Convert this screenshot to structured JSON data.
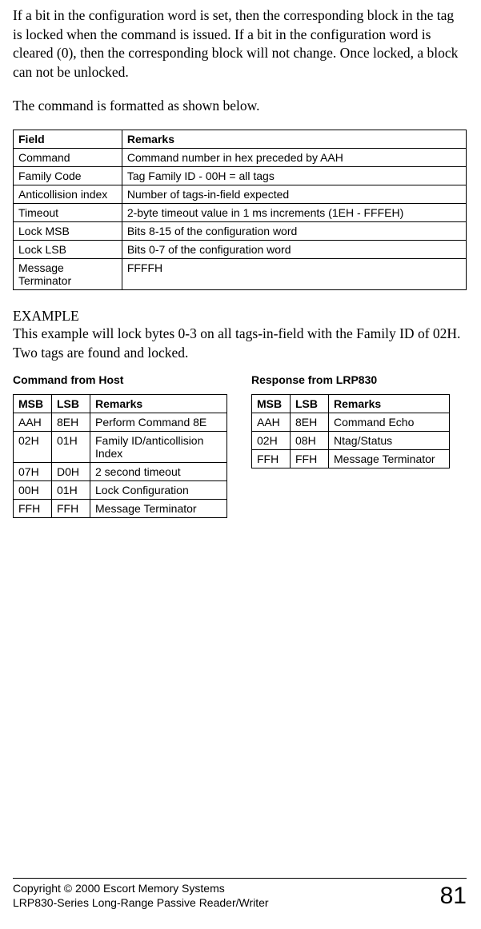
{
  "para1": "If a bit in the configuration word is set, then the corresponding block in the tag is locked when the command is issued. If a bit in the configuration word is cleared (0), then the corresponding block will not change. Once locked, a block can not be unlocked.",
  "para2": "The command is formatted as shown below.",
  "main_table": {
    "headers": {
      "field": "Field",
      "remarks": "Remarks"
    },
    "rows": [
      {
        "field": "Command",
        "remarks": "Command number in hex preceded by AAH"
      },
      {
        "field": "Family Code",
        "remarks": "Tag Family ID - 00H = all tags"
      },
      {
        "field": "Anticollision index",
        "remarks": "Number of tags-in-field expected"
      },
      {
        "field": "Timeout",
        "remarks": "2-byte timeout value in 1 ms increments (1EH - FFFEH)"
      },
      {
        "field": "Lock MSB",
        "remarks": "Bits 8-15 of the configuration word"
      },
      {
        "field": "Lock LSB",
        "remarks": "Bits 0-7 of the configuration word"
      },
      {
        "field": "Message Terminator",
        "remarks": "FFFFH"
      }
    ]
  },
  "example": {
    "heading": "EXAMPLE",
    "body": "This example will lock bytes 0-3 on all tags-in-field with the Family ID of 02H. Two tags are found and locked."
  },
  "host": {
    "title": "Command from Host",
    "headers": {
      "msb": "MSB",
      "lsb": "LSB",
      "remarks": "Remarks"
    },
    "rows": [
      {
        "msb": "AAH",
        "lsb": "8EH",
        "remarks": "Perform Command 8E"
      },
      {
        "msb": "02H",
        "lsb": "01H",
        "remarks": "Family ID/anticollision Index"
      },
      {
        "msb": "07H",
        "lsb": "D0H",
        "remarks": "2 second timeout"
      },
      {
        "msb": "00H",
        "lsb": "01H",
        "remarks": "Lock Configuration"
      },
      {
        "msb": "FFH",
        "lsb": "FFH",
        "remarks": "Message Terminator"
      }
    ]
  },
  "resp": {
    "title": "Response from LRP830",
    "headers": {
      "msb": "MSB",
      "lsb": "LSB",
      "remarks": "Remarks"
    },
    "rows": [
      {
        "msb": "AAH",
        "lsb": "8EH",
        "remarks": "Command Echo"
      },
      {
        "msb": "02H",
        "lsb": "08H",
        "remarks": "Ntag/Status"
      },
      {
        "msb": "FFH",
        "lsb": "FFH",
        "remarks": "Message Terminator"
      }
    ]
  },
  "footer": {
    "line1": "Copyright © 2000 Escort Memory Systems",
    "line2": "LRP830-Series Long-Range Passive Reader/Writer",
    "page": "81"
  }
}
